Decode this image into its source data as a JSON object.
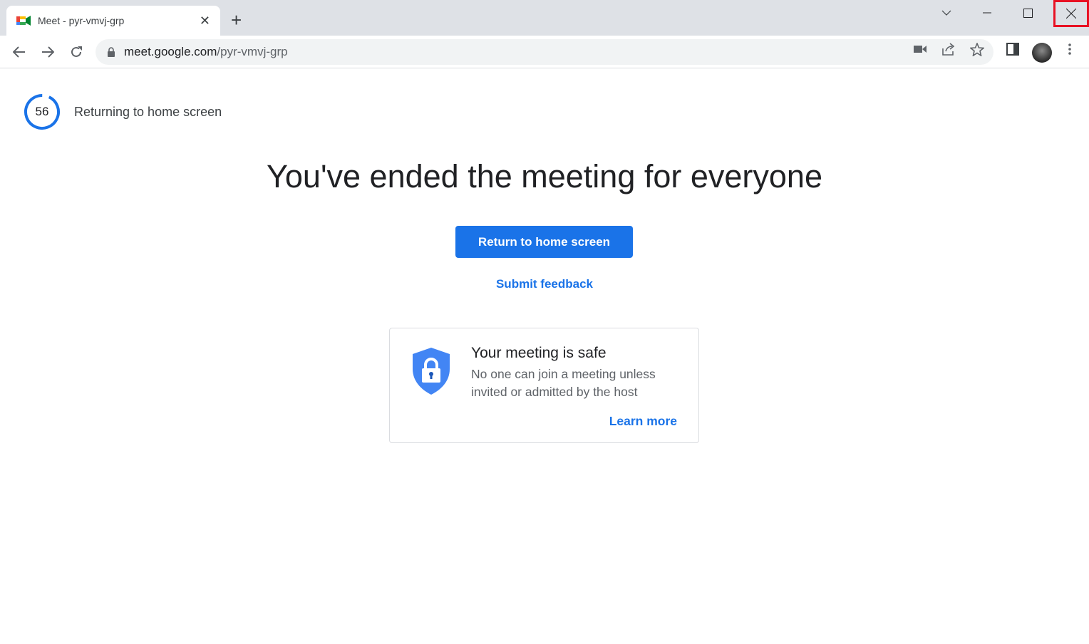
{
  "browser": {
    "tab": {
      "title": "Meet - pyr-vmvj-grp",
      "favicon": "google-meet-icon"
    },
    "url_host": "meet.google.com",
    "url_path": "/pyr-vmvj-grp",
    "highlighted_control": "window-close-button",
    "highlight_color": "#e81123"
  },
  "page": {
    "countdown": {
      "value": "56",
      "progress_fraction": 0.93,
      "color": "#1a73e8"
    },
    "returning_text": "Returning to home screen",
    "heading": "You've ended the meeting for everyone",
    "return_button": "Return to home screen",
    "feedback_link": "Submit feedback",
    "safety_card": {
      "title": "Your meeting is safe",
      "body": "No one can join a meeting unless invited or admitted by the host",
      "link": "Learn more",
      "icon": "shield-lock-icon"
    },
    "accent_color": "#1a73e8"
  }
}
